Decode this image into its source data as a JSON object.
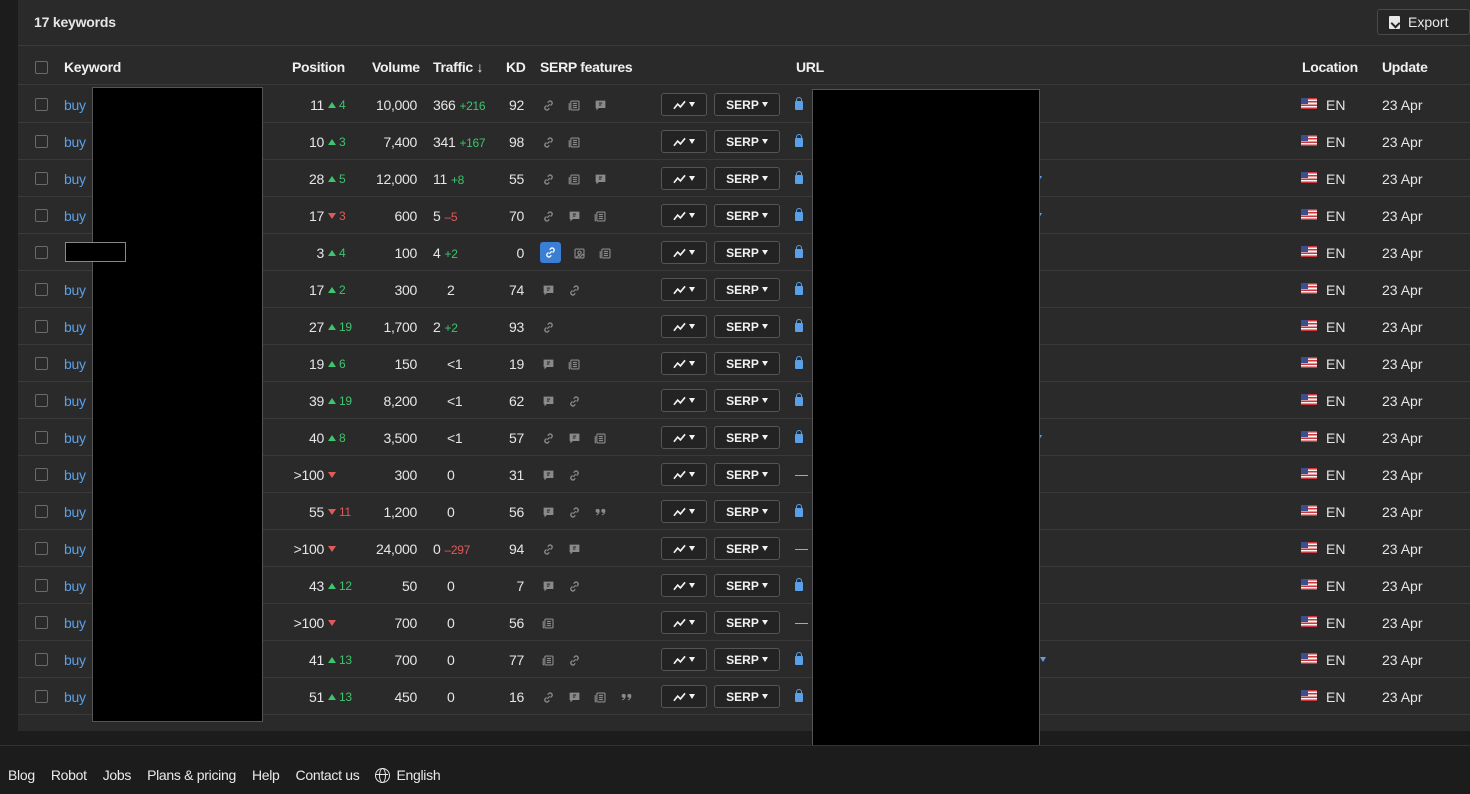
{
  "header": {
    "keyword_count": "17 keywords",
    "export_label": "Export"
  },
  "columns": {
    "keyword": "Keyword",
    "position": "Position",
    "volume": "Volume",
    "traffic": "Traffic ↓",
    "kd": "KD",
    "serp_features": "SERP features",
    "url": "URL",
    "location": "Location",
    "update": "Update"
  },
  "buttons": {
    "serp": "SERP"
  },
  "rows": [
    {
      "kw": "buy",
      "pos": "11",
      "pdir": "up",
      "pdelta": "4",
      "vol": "10,000",
      "traffic": "366",
      "tdelta": "+216",
      "tdir": "up",
      "kd": "92",
      "feats": [
        "link",
        "news",
        "review"
      ],
      "url": "lock",
      "caret": false,
      "loc": "EN",
      "upd": "23 Apr"
    },
    {
      "kw": "buy",
      "pos": "10",
      "pdir": "up",
      "pdelta": "3",
      "vol": "7,400",
      "traffic": "341",
      "tdelta": "+167",
      "tdir": "up",
      "kd": "98",
      "feats": [
        "link",
        "news"
      ],
      "url": "lock",
      "caret": false,
      "loc": "EN",
      "upd": "23 Apr"
    },
    {
      "kw": "buy",
      "pos": "28",
      "pdir": "up",
      "pdelta": "5",
      "vol": "12,000",
      "traffic": "11",
      "tdelta": "+8",
      "tdir": "up",
      "kd": "55",
      "feats": [
        "link",
        "news",
        "review"
      ],
      "url": "lock",
      "caret": true,
      "loc": "EN",
      "upd": "23 Apr"
    },
    {
      "kw": "buy",
      "pos": "17",
      "pdir": "down",
      "pdelta": "3",
      "vol": "600",
      "traffic": "5",
      "tdelta": "–5",
      "tdir": "down",
      "kd": "70",
      "feats": [
        "link",
        "review",
        "news"
      ],
      "url": "lock",
      "caret": true,
      "loc": "EN",
      "upd": "23 Apr"
    },
    {
      "kw": "",
      "pos": "3",
      "pdir": "up",
      "pdelta": "4",
      "vol": "100",
      "traffic": "4",
      "tdelta": "+2",
      "tdir": "up",
      "kd": "0",
      "feats": [
        "link-active",
        "image",
        "news"
      ],
      "url": "lock",
      "caret": false,
      "loc": "EN",
      "upd": "23 Apr"
    },
    {
      "kw": "buy",
      "pos": "17",
      "pdir": "up",
      "pdelta": "2",
      "vol": "300",
      "traffic": "2",
      "tdelta": "",
      "tdir": "",
      "kd": "74",
      "feats": [
        "review",
        "link"
      ],
      "url": "lock",
      "caret": false,
      "loc": "EN",
      "upd": "23 Apr"
    },
    {
      "kw": "buy",
      "pos": "27",
      "pdir": "up",
      "pdelta": "19",
      "vol": "1,700",
      "traffic": "2",
      "tdelta": "+2",
      "tdir": "up",
      "kd": "93",
      "feats": [
        "link"
      ],
      "url": "lock",
      "caret": false,
      "loc": "EN",
      "upd": "23 Apr"
    },
    {
      "kw": "buy",
      "pos": "19",
      "pdir": "up",
      "pdelta": "6",
      "vol": "150",
      "traffic": "<1",
      "tdelta": "",
      "tdir": "",
      "kd": "19",
      "feats": [
        "review",
        "news"
      ],
      "url": "lock",
      "caret": false,
      "loc": "EN",
      "upd": "23 Apr"
    },
    {
      "kw": "buy",
      "pos": "39",
      "pdir": "up",
      "pdelta": "19",
      "vol": "8,200",
      "traffic": "<1",
      "tdelta": "",
      "tdir": "",
      "kd": "62",
      "feats": [
        "review",
        "link"
      ],
      "url": "lock",
      "caret": false,
      "loc": "EN",
      "upd": "23 Apr"
    },
    {
      "kw": "buy",
      "pos": "40",
      "pdir": "up",
      "pdelta": "8",
      "vol": "3,500",
      "traffic": "<1",
      "tdelta": "",
      "tdir": "",
      "kd": "57",
      "feats": [
        "link",
        "review",
        "news"
      ],
      "url": "lock",
      "caret": true,
      "loc": "EN",
      "upd": "23 Apr"
    },
    {
      "kw": "buy",
      "pos": ">100",
      "pdir": "down",
      "pdelta": "",
      "vol": "300",
      "traffic": "0",
      "tdelta": "",
      "tdir": "",
      "kd": "31",
      "feats": [
        "review",
        "link"
      ],
      "url": "dash",
      "caret": false,
      "loc": "EN",
      "upd": "23 Apr"
    },
    {
      "kw": "buy",
      "pos": "55",
      "pdir": "down",
      "pdelta": "11",
      "vol": "1,200",
      "traffic": "0",
      "tdelta": "",
      "tdir": "",
      "kd": "56",
      "feats": [
        "review",
        "link",
        "quote"
      ],
      "url": "lock",
      "caret": false,
      "loc": "EN",
      "upd": "23 Apr"
    },
    {
      "kw": "buy",
      "pos": ">100",
      "pdir": "down",
      "pdelta": "",
      "vol": "24,000",
      "traffic": "0",
      "tdelta": "–297",
      "tdir": "down",
      "kd": "94",
      "feats": [
        "link",
        "review"
      ],
      "url": "dash",
      "caret": false,
      "loc": "EN",
      "upd": "23 Apr"
    },
    {
      "kw": "buy",
      "pos": "43",
      "pdir": "up",
      "pdelta": "12",
      "vol": "50",
      "traffic": "0",
      "tdelta": "",
      "tdir": "",
      "kd": "7",
      "feats": [
        "review",
        "link"
      ],
      "url": "lock",
      "caret": false,
      "loc": "EN",
      "upd": "23 Apr"
    },
    {
      "kw": "buy",
      "pos": ">100",
      "pdir": "down",
      "pdelta": "",
      "vol": "700",
      "traffic": "0",
      "tdelta": "",
      "tdir": "",
      "kd": "56",
      "feats": [
        "news"
      ],
      "url": "dash",
      "caret": false,
      "loc": "EN",
      "upd": "23 Apr"
    },
    {
      "kw": "buy",
      "pos": "41",
      "pdir": "up",
      "pdelta": "13",
      "vol": "700",
      "traffic": "0",
      "tdelta": "",
      "tdir": "",
      "kd": "77",
      "feats": [
        "news",
        "link"
      ],
      "url": "lock",
      "caret": true,
      "loc": "EN",
      "upd": "23 Apr"
    },
    {
      "kw": "buy",
      "pos": "51",
      "pdir": "up",
      "pdelta": "13",
      "vol": "450",
      "traffic": "0",
      "tdelta": "",
      "tdir": "",
      "kd": "16",
      "feats": [
        "link",
        "review",
        "news",
        "quote"
      ],
      "url": "lock",
      "caret": false,
      "loc": "EN",
      "upd": "23 Apr"
    }
  ],
  "url_dash": "—",
  "footer": {
    "links": [
      "Blog",
      "Robot",
      "Jobs",
      "Plans & pricing",
      "Help",
      "Contact us"
    ],
    "language": "English"
  }
}
